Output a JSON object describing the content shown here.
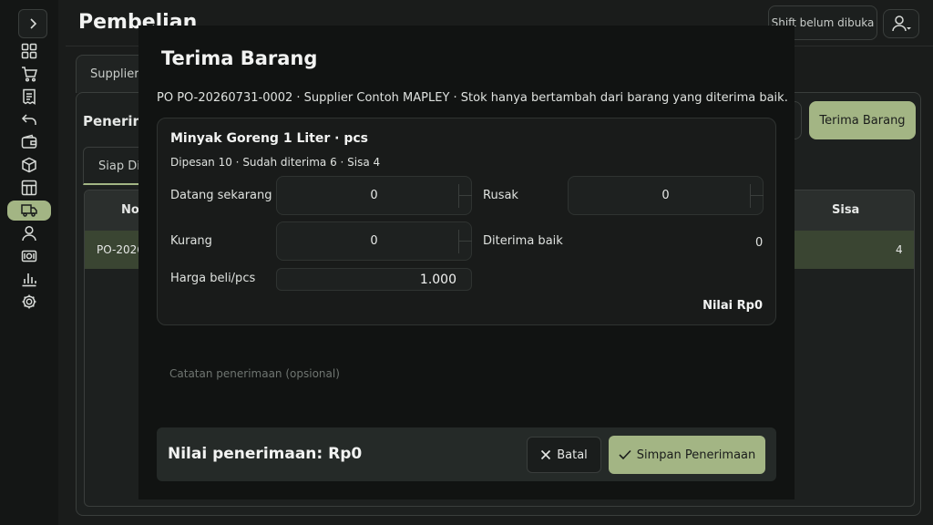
{
  "header": {
    "title": "Pembelian",
    "shift_label": "Shift belum dibuka"
  },
  "sidebar": {
    "items": [
      {
        "icon": "grid-icon"
      },
      {
        "icon": "cart-icon"
      },
      {
        "icon": "receipt-icon"
      },
      {
        "icon": "undo-icon"
      },
      {
        "icon": "wallet-icon"
      },
      {
        "icon": "box-icon"
      },
      {
        "icon": "table-icon"
      },
      {
        "icon": "truck-icon",
        "active": true
      },
      {
        "icon": "user-icon"
      },
      {
        "icon": "cash-icon"
      },
      {
        "icon": "bar-chart-icon"
      },
      {
        "icon": "gear-icon"
      }
    ]
  },
  "background": {
    "tab_label": "Supplier",
    "section_heading": "Penerim",
    "receive_button": "Terima Barang",
    "subtab_label": "Siap Di",
    "table": {
      "col_no": "No",
      "col_sisa": "Sisa",
      "row_po": "PO-2026",
      "row_sisa": "4"
    }
  },
  "modal": {
    "title": "Terima Barang",
    "info": "PO PO-20260731-0002 · Supplier Contoh MAPLEY · Stok hanya bertambah dari barang yang diterima baik.",
    "item": {
      "name": "Minyak Goreng 1 Liter · pcs",
      "meta": "Dipesan 10 · Sudah diterima 6 · Sisa 4",
      "datang_label": "Datang sekarang",
      "datang_value": "0",
      "rusak_label": "Rusak",
      "rusak_value": "0",
      "kurang_label": "Kurang",
      "kurang_value": "0",
      "diterima_label": "Diterima baik",
      "diterima_value": "0",
      "harga_label": "Harga beli/pcs",
      "harga_value": "1.000",
      "nilai": "Nilai Rp0"
    },
    "note_placeholder": "Catatan penerimaan (opsional)",
    "footer": {
      "total": "Nilai penerimaan: Rp0",
      "cancel_label": "Batal",
      "save_label": "Simpan Penerimaan"
    }
  },
  "colors": {
    "accent": "#a3b584",
    "background": "#1a1c1b",
    "modal": "#111312"
  }
}
